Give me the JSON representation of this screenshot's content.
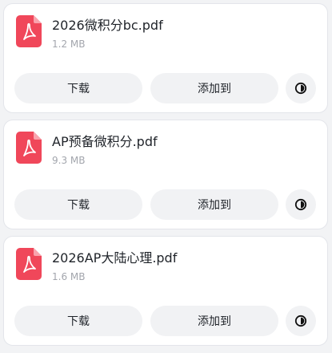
{
  "files": [
    {
      "name": "2026微积分bc.pdf",
      "size": "1.2 MB",
      "icon": "pdf-file-icon"
    },
    {
      "name": "AP预备微积分.pdf",
      "size": "9.3 MB",
      "icon": "pdf-file-icon"
    },
    {
      "name": "2026AP大陆心理.pdf",
      "size": "1.6 MB",
      "icon": "pdf-file-icon"
    }
  ],
  "actions": {
    "download_label": "下载",
    "add_to_label": "添加到",
    "more_icon": "circle-toggle-icon"
  },
  "colors": {
    "pdf_icon": "#f0475a",
    "card_bg": "#ffffff",
    "button_bg": "#f1f2f4",
    "page_bg": "#f2f3f5"
  }
}
